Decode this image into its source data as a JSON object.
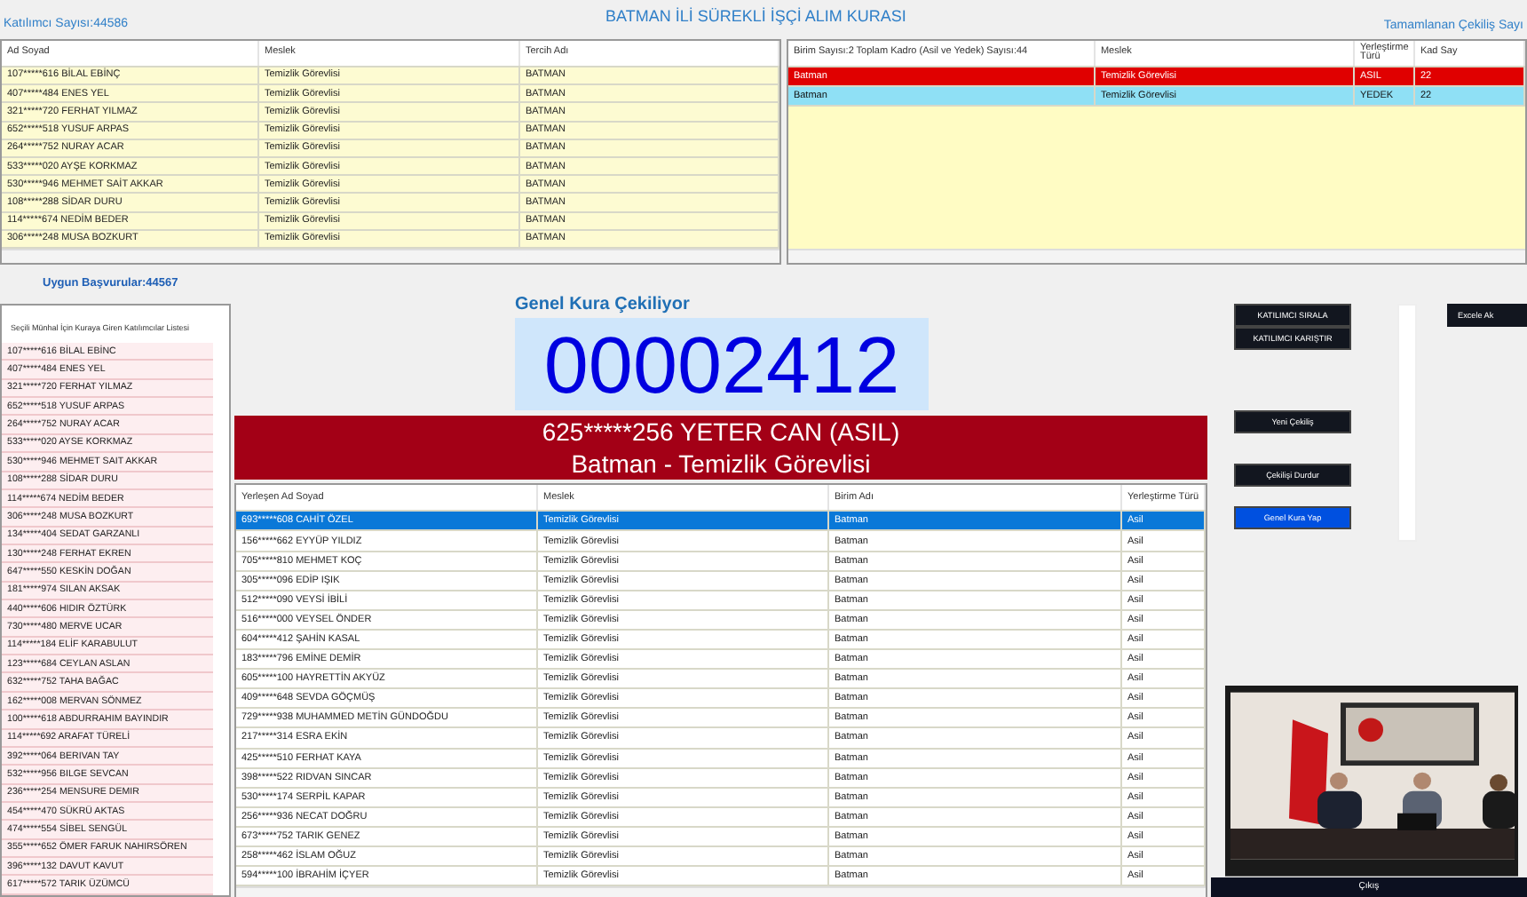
{
  "header": {
    "participant_count": "Katılımcı Sayısı:44586",
    "title": "BATMAN İLİ SÜREKLİ İŞÇİ ALIM KURASI",
    "completed_label": "Tamamlanan Çekiliş Sayı"
  },
  "participants_table": {
    "columns": [
      "Ad Soyad",
      "Meslek",
      "Tercih Adı"
    ],
    "rows": [
      [
        "107*****616 BİLAL EBİNÇ",
        "Temizlik Görevlisi",
        "BATMAN"
      ],
      [
        "407*****484 ENES YEL",
        "Temizlik Görevlisi",
        "BATMAN"
      ],
      [
        "321*****720 FERHAT YILMAZ",
        "Temizlik Görevlisi",
        "BATMAN"
      ],
      [
        "652*****518 YUSUF ARPAS",
        "Temizlik Görevlisi",
        "BATMAN"
      ],
      [
        "264*****752 NURAY ACAR",
        "Temizlik Görevlisi",
        "BATMAN"
      ],
      [
        "533*****020 AYŞE KORKMAZ",
        "Temizlik Görevlisi",
        "BATMAN"
      ],
      [
        "530*****946 MEHMET SAİT AKKAR",
        "Temizlik Görevlisi",
        "BATMAN"
      ],
      [
        "108*****288 SİDAR DURU",
        "Temizlik Görevlisi",
        "BATMAN"
      ],
      [
        "114*****674 NEDİM BEDER",
        "Temizlik Görevlisi",
        "BATMAN"
      ],
      [
        "306*****248 MUSA BOZKURT",
        "Temizlik Görevlisi",
        "BATMAN"
      ]
    ]
  },
  "units_table": {
    "columns": [
      "Birim Sayısı:2 Toplam Kadro (Asil ve Yedek) Sayısı:44",
      "Meslek",
      "Yerleştirme Türü",
      "Kad Say"
    ],
    "rows": [
      {
        "cells": [
          "Batman",
          "Temizlik Görevlisi",
          "ASIL",
          "22"
        ],
        "color": "#e00000"
      },
      {
        "cells": [
          "Batman",
          "Temizlik Görevlisi",
          "YEDEK",
          "22"
        ],
        "color": "#8fe0f5"
      }
    ]
  },
  "eligible": {
    "label": "Uygun Başvurular:44567",
    "list_title": "Seçili Münhal İçin Kuraya Giren Katılımcılar Listesi",
    "items": [
      "107*****616 BİLAL EBİNC",
      "407*****484 ENES YEL",
      "321*****720 FERHAT YILMAZ",
      "652*****518 YUSUF ARPAS",
      "264*****752 NURAY ACAR",
      "533*****020 AYSE KORKMAZ",
      "530*****946 MEHMET SAIT AKKAR",
      "108*****288 SİDAR DURU",
      "114*****674 NEDİM BEDER",
      "306*****248 MUSA BOZKURT",
      "134*****404 SEDAT GARZANLI",
      "130*****248 FERHAT EKREN",
      "647*****550 KESKİN DOĞAN",
      "181*****974 SILAN AKSAK",
      "440*****606 HIDIR ÖZTÜRK",
      "730*****480 MERVE UCAR",
      "114*****184 ELİF KARABULUT",
      "123*****684 CEYLAN ASLAN",
      "632*****752 TAHA BAĞAC",
      "162*****008 MERVAN SÖNMEZ",
      "100*****618 ABDURRAHIM BAYINDIR",
      "114*****692 ARAFAT TÜRELİ",
      "392*****064 BERIVAN TAY",
      "532*****956 BILGE SEVCAN",
      "236*****254 MENSURE DEMIR",
      "454*****470 SÜKRÜ AKTAS",
      "474*****554 SİBEL SENGÜL",
      "355*****652 ÖMER FARUK NAHIRSÖREN",
      "396*****132 DAVUT KAVUT",
      "617*****572 TARIK ÜZÜMCÜ"
    ]
  },
  "draw": {
    "status": "Genel Kura Çekiliyor",
    "number": "00002412",
    "winner": "625*****256 YETER CAN (ASIL)",
    "winner_detail": "Batman - Temizlik Görevlisi"
  },
  "placed_table": {
    "columns": [
      "Yerleşen Ad Soyad",
      "Meslek",
      "Birim Adı",
      "Yerleştirme Türü"
    ],
    "rows": [
      {
        "cells": [
          "693*****608 CAHİT ÖZEL",
          "Temizlik Görevlisi",
          "Batman",
          "Asil"
        ],
        "selected": true
      },
      {
        "cells": [
          "156*****662 EYYÜP YILDIZ",
          "Temizlik Görevlisi",
          "Batman",
          "Asil"
        ],
        "selected": false
      },
      {
        "cells": [
          "705*****810 MEHMET KOÇ",
          "Temizlik Görevlisi",
          "Batman",
          "Asil"
        ],
        "selected": false
      },
      {
        "cells": [
          "305*****096 EDİP IŞIK",
          "Temizlik Görevlisi",
          "Batman",
          "Asil"
        ],
        "selected": false
      },
      {
        "cells": [
          "512*****090 VEYSİ İBİLİ",
          "Temizlik Görevlisi",
          "Batman",
          "Asil"
        ],
        "selected": false
      },
      {
        "cells": [
          "516*****000 VEYSEL ÖNDER",
          "Temizlik Görevlisi",
          "Batman",
          "Asil"
        ],
        "selected": false
      },
      {
        "cells": [
          "604*****412 ŞAHİN KASAL",
          "Temizlik Görevlisi",
          "Batman",
          "Asil"
        ],
        "selected": false
      },
      {
        "cells": [
          "183*****796 EMİNE DEMİR",
          "Temizlik Görevlisi",
          "Batman",
          "Asil"
        ],
        "selected": false
      },
      {
        "cells": [
          "605*****100 HAYRETTİN AKYÜZ",
          "Temizlik Görevlisi",
          "Batman",
          "Asil"
        ],
        "selected": false
      },
      {
        "cells": [
          "409*****648 SEVDA GÖÇMÜŞ",
          "Temizlik Görevlisi",
          "Batman",
          "Asil"
        ],
        "selected": false
      },
      {
        "cells": [
          "729*****938 MUHAMMED METİN GÜNDOĞDU",
          "Temizlik Görevlisi",
          "Batman",
          "Asil"
        ],
        "selected": false
      },
      {
        "cells": [
          "217*****314 ESRA EKİN",
          "Temizlik Görevlisi",
          "Batman",
          "Asil"
        ],
        "selected": false
      },
      {
        "cells": [
          "425*****510 FERHAT KAYA",
          "Temizlik Görevlisi",
          "Batman",
          "Asil"
        ],
        "selected": false
      },
      {
        "cells": [
          "398*****522 RIDVAN SINCAR",
          "Temizlik Görevlisi",
          "Batman",
          "Asil"
        ],
        "selected": false
      },
      {
        "cells": [
          "530*****174 SERPİL KAPAR",
          "Temizlik Görevlisi",
          "Batman",
          "Asil"
        ],
        "selected": false
      },
      {
        "cells": [
          "256*****936 NECAT DOĞRU",
          "Temizlik Görevlisi",
          "Batman",
          "Asil"
        ],
        "selected": false
      },
      {
        "cells": [
          "673*****752 TARIK GENEZ",
          "Temizlik Görevlisi",
          "Batman",
          "Asil"
        ],
        "selected": false
      },
      {
        "cells": [
          "258*****462 İSLAM OĞUZ",
          "Temizlik Görevlisi",
          "Batman",
          "Asil"
        ],
        "selected": false
      },
      {
        "cells": [
          "594*****100 İBRAHİM İÇYER",
          "Temizlik Görevlisi",
          "Batman",
          "Asil"
        ],
        "selected": false
      }
    ]
  },
  "controls": {
    "buttons": [
      {
        "label": "KATILIMCI SIRALA",
        "selected": false
      },
      {
        "label": "KATILIMCI KARIŞTIR",
        "selected": false
      },
      {
        "label": "Yeni Çekiliş",
        "selected": false
      },
      {
        "label": "Çekilişi Durdur",
        "selected": false
      },
      {
        "label": "Genel Kura Yap",
        "selected": true
      }
    ],
    "export_button": "Excele Ak",
    "exit_button": "Çıkış"
  }
}
